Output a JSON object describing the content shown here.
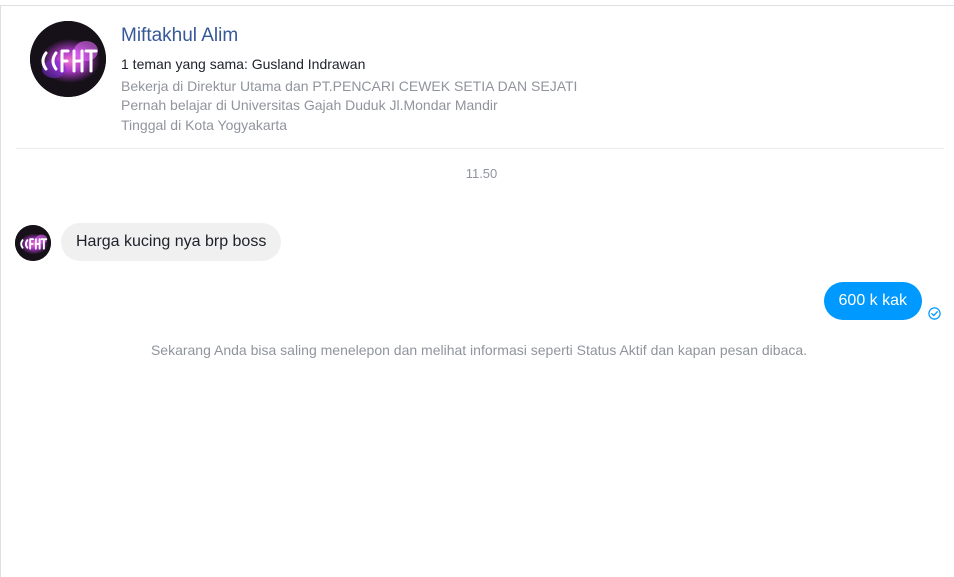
{
  "profile": {
    "name": "Miftakhul Alim",
    "avatar_icon": "profile-avatar-neon-logo",
    "mutual_friends": "1 teman yang sama: Gusland Indrawan",
    "work": "Bekerja di Direktur Utama dan PT.PENCARI CEWEK SETIA DAN SEJATI",
    "study": "Pernah belajar di Universitas Gajah Duduk Jl.Mondar Mandir",
    "lives": "Tinggal di Kota Yogyakarta"
  },
  "conversation": {
    "timestamp": "11.50",
    "messages": [
      {
        "direction": "incoming",
        "text": "Harga kucing nya brp boss"
      },
      {
        "direction": "outgoing",
        "text": "600 k kak",
        "status_icon": "check-circle-icon"
      }
    ],
    "notice": "Sekarang Anda bisa saling menelepon dan melihat informasi seperti Status Aktif dan kapan pesan dibaca."
  },
  "colors": {
    "name_link": "#365899",
    "outgoing_bubble": "#0099ff",
    "incoming_bubble": "#f1f0f0",
    "secondary_text": "#90949c"
  }
}
